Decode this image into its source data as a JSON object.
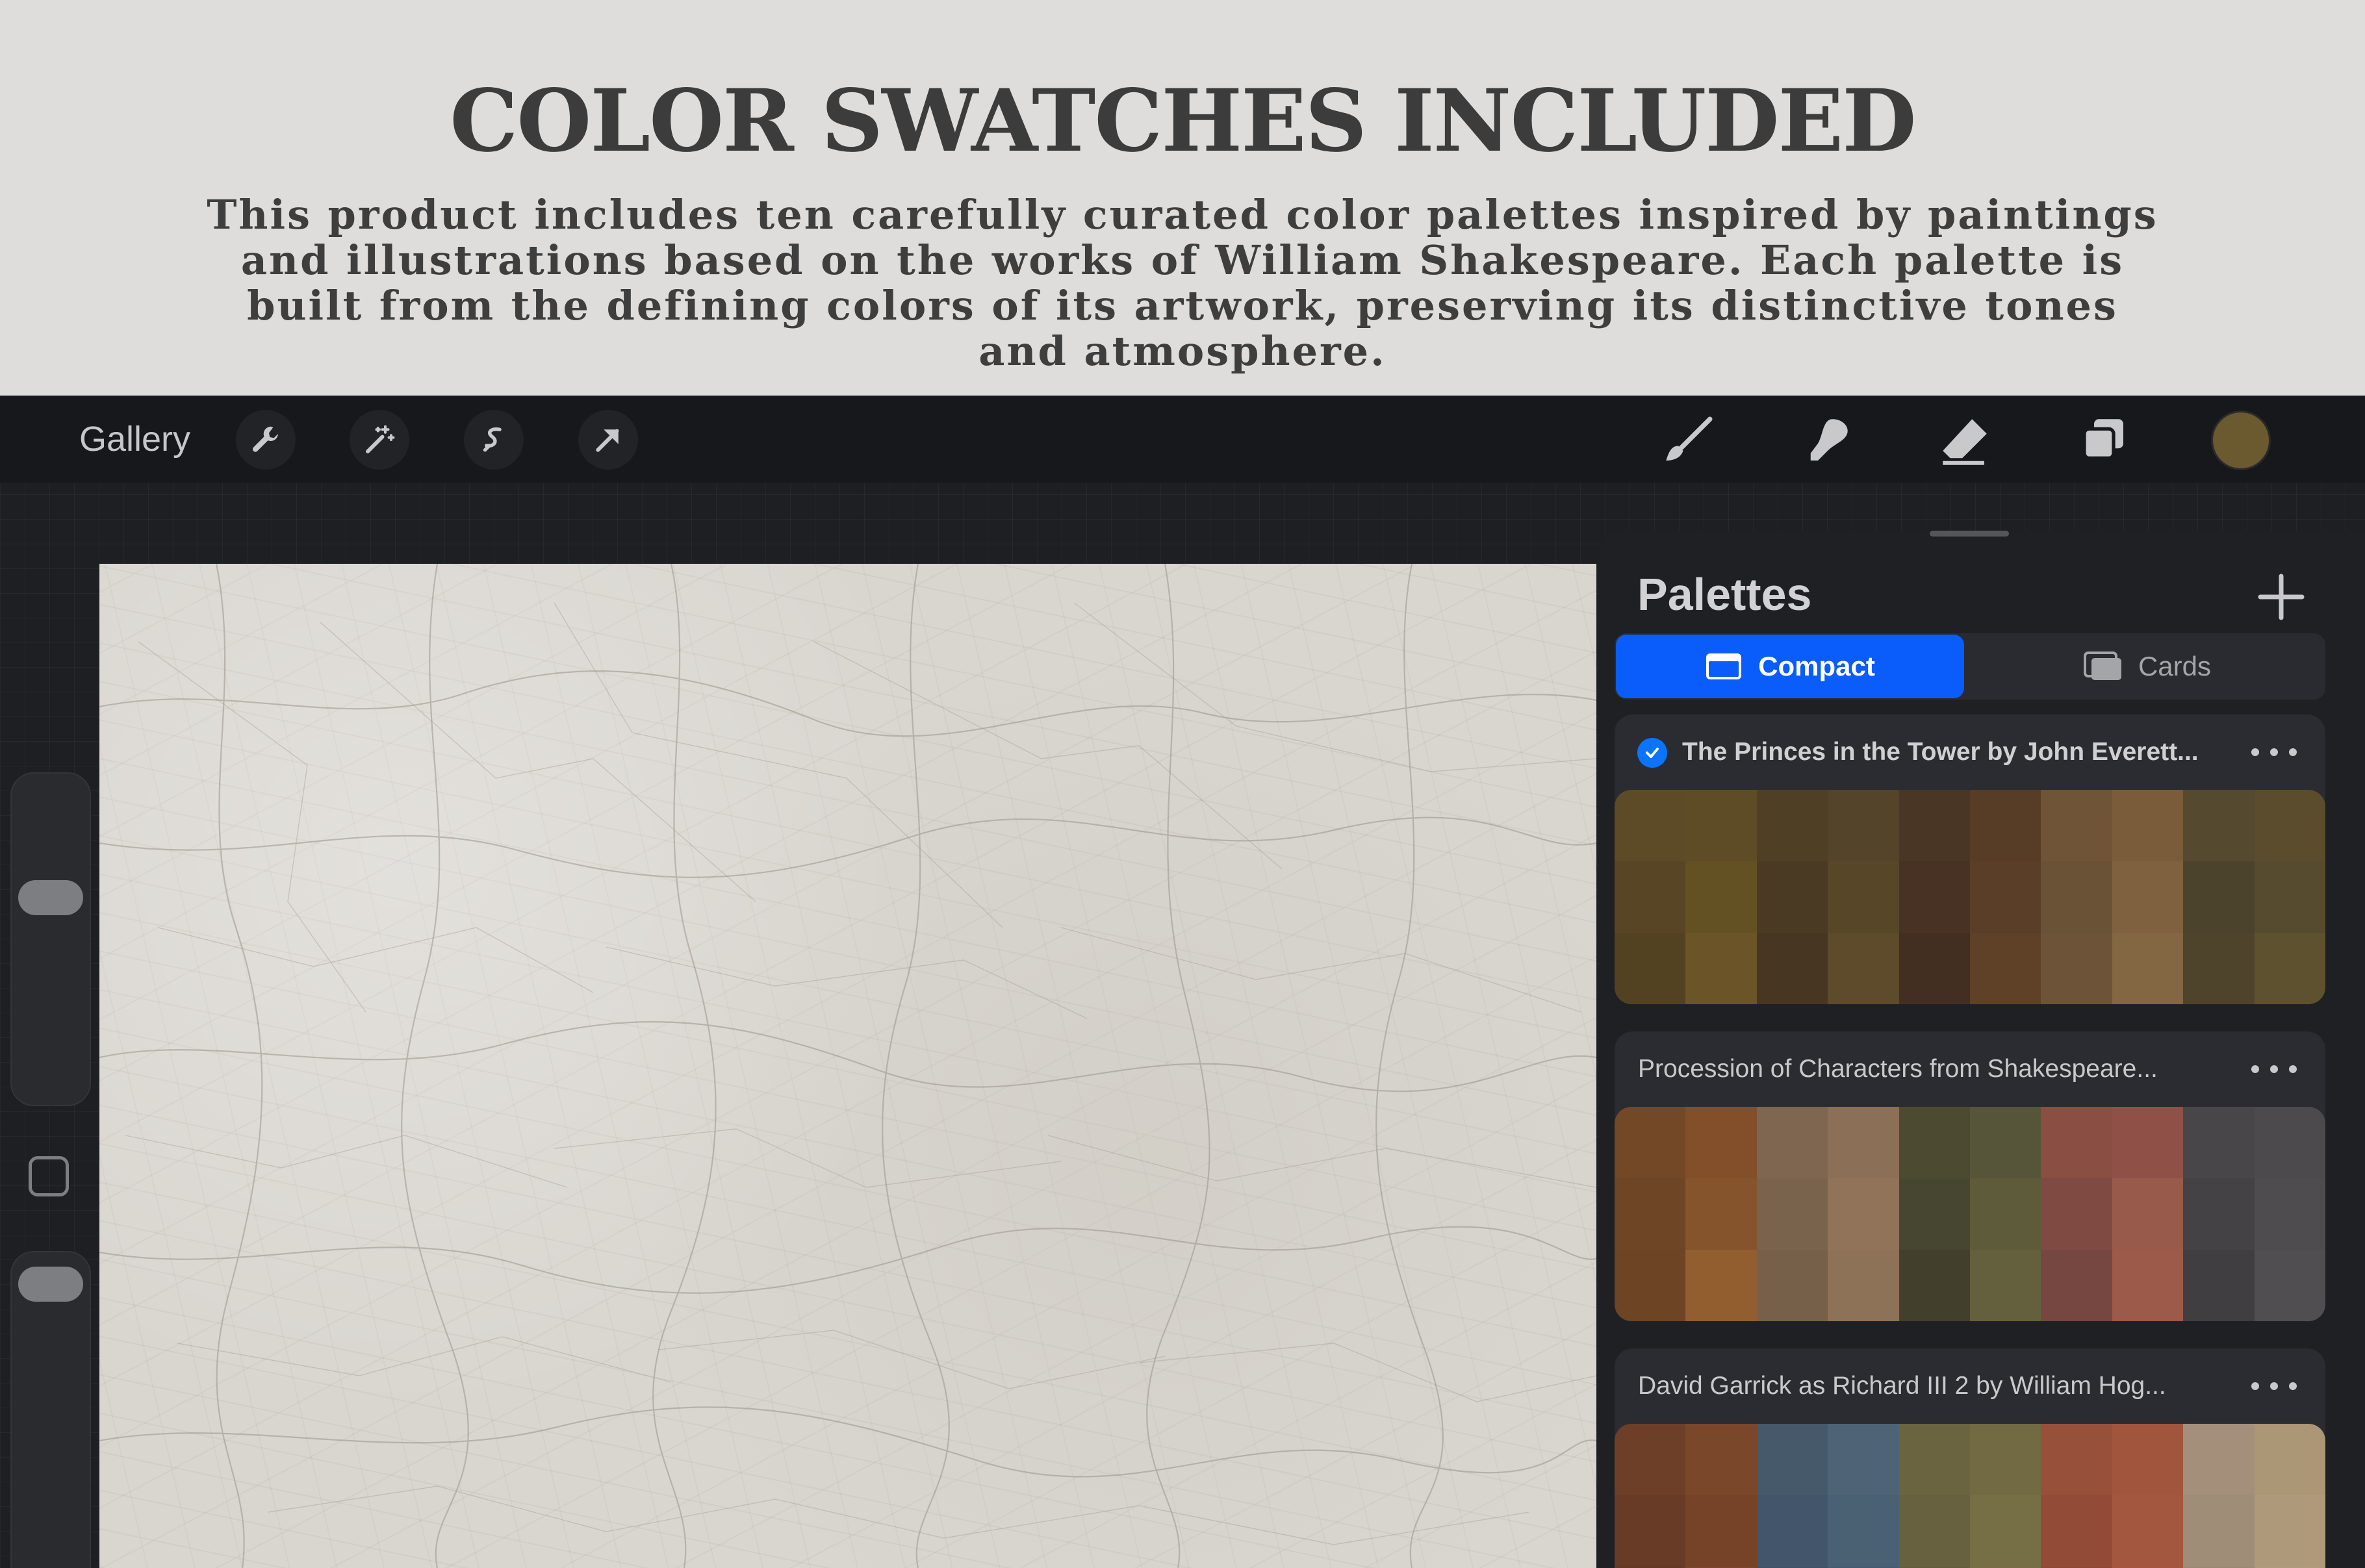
{
  "promo": {
    "title": "COLOR SWATCHES INCLUDED",
    "body": "This product includes ten carefully curated color palettes inspired by paintings and illustrations based on the works of William Shakespeare. Each palette is built from the defining colors of its artwork, preserving its distinctive tones and atmosphere."
  },
  "toolbar": {
    "gallery_label": "Gallery",
    "left_icons": [
      "wrench-icon",
      "magic-wand-icon",
      "selection-icon",
      "move-arrow-icon"
    ],
    "right_icons": [
      "brush-icon",
      "smudge-icon",
      "eraser-icon",
      "layers-icon"
    ],
    "active_color": "#6b5a2f"
  },
  "panel": {
    "title": "Palettes",
    "view_modes": {
      "compact_label": "Compact",
      "cards_label": "Cards",
      "selected": "Compact"
    },
    "accent": "#0a5dfb",
    "palettes": [
      {
        "name": "The Princes in the Tower by John Everett...",
        "is_default": true,
        "swatches": [
          "#5d4b27",
          "#5d4c25",
          "#4f3f24",
          "#54442a",
          "#4a3625",
          "#573c26",
          "#6f5437",
          "#7a5b3a",
          "#554a30",
          "#5a4c2c",
          "#574526",
          "#635124",
          "#4a3a24",
          "#574628",
          "#473223",
          "#5b3e27",
          "#6a5237",
          "#80613f",
          "#4c432c",
          "#564b2e",
          "#534222",
          "#6a5428",
          "#463622",
          "#5e4b2b",
          "#432f21",
          "#5e4126",
          "#6d5337",
          "#836642",
          "#4d442b",
          "#5d5130"
        ]
      },
      {
        "name": "Procession of Characters from Shakespeare...",
        "is_default": false,
        "swatches": [
          "#734826",
          "#824f2a",
          "#7f6650",
          "#8b6f56",
          "#4c4b32",
          "#56553a",
          "#8a4e43",
          "#8f5147",
          "#49464a",
          "#4d4a4e",
          "#6f4625",
          "#86542c",
          "#7a634d",
          "#917359",
          "#474630",
          "#5d5b3a",
          "#7e4a42",
          "#985a4b",
          "#454246",
          "#4f4c50",
          "#6d4424",
          "#925e30",
          "#766049",
          "#8e7258",
          "#433f2d",
          "#64603d",
          "#764640",
          "#9c5a4b",
          "#413e42",
          "#514e52"
        ]
      },
      {
        "name": "David Garrick as Richard III 2 by William Hog...",
        "is_default": false,
        "swatches": [
          "#6d3f28",
          "#7a472a",
          "#46596a",
          "#4e6375",
          "#6a6440",
          "#716a43",
          "#97503a",
          "#a0553c",
          "#a4907a",
          "#ab9676",
          "#673b26",
          "#764328",
          "#43556a",
          "#4a6073",
          "#676140",
          "#766e44",
          "#924b36",
          "#a3573e",
          "#a08d77",
          "#ae9a7a",
          "#633a25",
          "#7a4529",
          "#405264",
          "#475c70",
          "#645e3d",
          "#786f45",
          "#8d4934",
          "#a5583f",
          "#9c8a74",
          "#b09c7c"
        ]
      }
    ]
  }
}
